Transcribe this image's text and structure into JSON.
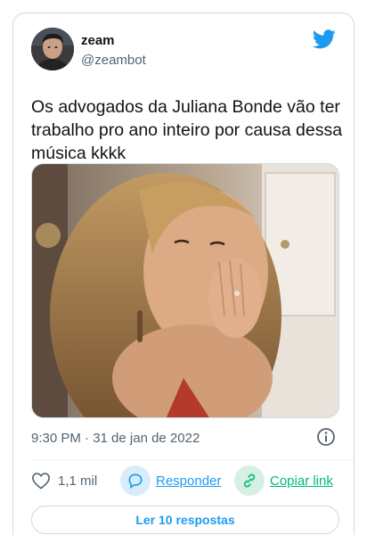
{
  "author": {
    "name": "zeam",
    "handle": "@zeambot",
    "avatar_icon": "user-avatar"
  },
  "brand": {
    "logo_icon": "twitter-bird-icon",
    "color": "#1d9bf0"
  },
  "tweet": {
    "text": "Os advogados da Juliana Bonde vão ter trabalho pro ano inteiro por causa dessa música kkkk",
    "timestamp": "9:30 PM · 31 de jan de 2022"
  },
  "actions": {
    "like_count": "1,1 mil",
    "reply_label": "Responder",
    "copy_label": "Copiar link"
  },
  "replies_button": "Ler 10 respostas",
  "colors": {
    "reply": "#1d9bf0",
    "copy": "#00ba7c",
    "muted": "#536471"
  }
}
